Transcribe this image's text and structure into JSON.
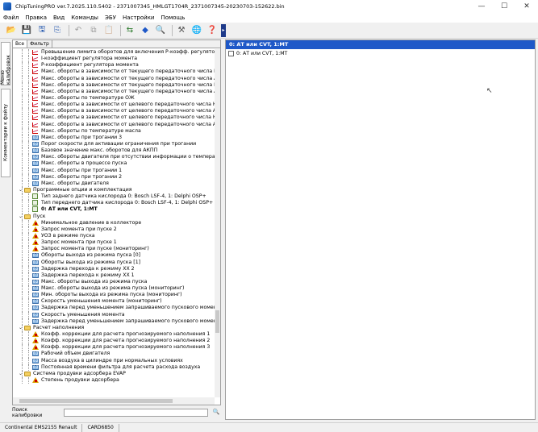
{
  "window": {
    "title": "ChipTuningPRO ver.7.2025.110.5402 - 2371007345_HMLGT1704R_2371007345-20230703-152622.bin"
  },
  "menu": [
    "Файл",
    "Правка",
    "Вид",
    "Команды",
    "ЭБУ",
    "Настройки",
    "Помощь"
  ],
  "side_tabs": {
    "tab1": "Меню калибровок",
    "tab2": "Комментарии к файлу"
  },
  "left_tabs": {
    "all": "Все",
    "filter": "Фильтр"
  },
  "tree": [
    {
      "d": 2,
      "i": "chart",
      "t": "Превышение лимита оборотов для включения Р-коэфф. регулятора м"
    },
    {
      "d": 2,
      "i": "chart",
      "t": "I-коэффициент регулятора момента"
    },
    {
      "d": 2,
      "i": "chart",
      "t": "P-коэффициент регулятора момента"
    },
    {
      "d": 2,
      "i": "chart",
      "t": "Макс. обороты  в зависимости от текущего передаточного числа КПП"
    },
    {
      "d": 2,
      "i": "chart",
      "t": "Макс. обороты  в зависимости от текущего передаточного числа АКПП"
    },
    {
      "d": 2,
      "i": "chart",
      "t": "Макс. обороты  в зависимости от текущего передаточного числа КПП"
    },
    {
      "d": 2,
      "i": "chart",
      "t": "Макс. обороты  в зависимости от текущего передаточного числа АКПП"
    },
    {
      "d": 2,
      "i": "chart",
      "t": "Макс. обороты по температуре ОЖ"
    },
    {
      "d": 2,
      "i": "chart",
      "t": "Макс. обороты  в зависимости от целевого передаточного числа КПП"
    },
    {
      "d": 2,
      "i": "chart",
      "t": "Макс. обороты  в зависимости от целевого передаточного числа АКПП"
    },
    {
      "d": 2,
      "i": "chart",
      "t": "Макс. обороты  в зависимости от целевого передаточного числа КПП"
    },
    {
      "d": 2,
      "i": "chart",
      "t": "Макс. обороты  в зависимости от целевого передаточного числа АКПП"
    },
    {
      "d": 2,
      "i": "chart",
      "t": "Макс. обороты по температуре масла"
    },
    {
      "d": 2,
      "i": "val",
      "t": "Макс. обороты при трогании 3"
    },
    {
      "d": 2,
      "i": "val",
      "t": "Порог скорости для активации ограничения при трогании"
    },
    {
      "d": 2,
      "i": "val",
      "t": "Базовое значение макс. оборотов для АКПП"
    },
    {
      "d": 2,
      "i": "val",
      "t": "Макс. обороты двигателя при отсутствии  информации о температуре"
    },
    {
      "d": 2,
      "i": "val",
      "t": "Макс. обороты в процессе пуска"
    },
    {
      "d": 2,
      "i": "val",
      "t": "Макс. обороты при трогании 1"
    },
    {
      "d": 2,
      "i": "val",
      "t": "Макс. обороты при трогании 2"
    },
    {
      "d": 2,
      "i": "val",
      "t": "Макс. обороты двигателя"
    },
    {
      "d": 1,
      "i": "folder",
      "e": "⌄",
      "t": "Программные опции и комплектация"
    },
    {
      "d": 2,
      "i": "edit",
      "t": "Тип заднего датчика кислорода 0: Bosch LSF-4, 1: Delphi OSP+"
    },
    {
      "d": 2,
      "i": "edit",
      "t": "Тип переднего датчика кислорода 0: Bosch LSF-4, 1: Delphi OSP+"
    },
    {
      "d": 2,
      "i": "edit",
      "t": "0: АТ или CVT, 1:МТ",
      "sel": true
    },
    {
      "d": 1,
      "i": "folder",
      "e": "⌄",
      "t": "Пуск"
    },
    {
      "d": 2,
      "i": "tri",
      "t": "Минимальное давление в коллекторе"
    },
    {
      "d": 2,
      "i": "tri",
      "t": "Запрос момента при пуске 2"
    },
    {
      "d": 2,
      "i": "tri",
      "t": "УОЗ в режиме пуска"
    },
    {
      "d": 2,
      "i": "tri",
      "t": "Запрос момента при пуске 1"
    },
    {
      "d": 2,
      "i": "tri",
      "t": "Запрос момента при пуске (мониторинг)"
    },
    {
      "d": 2,
      "i": "val",
      "t": "Обороты выхода из режима пуска [0]"
    },
    {
      "d": 2,
      "i": "val",
      "t": "Обороты выхода из режима пуска [1]"
    },
    {
      "d": 2,
      "i": "val",
      "t": "Задержка перехода к режиму ХХ 2"
    },
    {
      "d": 2,
      "i": "val",
      "t": "Задержка перехода к режиму ХХ 1"
    },
    {
      "d": 2,
      "i": "val",
      "t": "Макс. обороты выхода из режима пуска"
    },
    {
      "d": 2,
      "i": "val",
      "t": "Макс. обороты выхода из режима пуска (мониторинг)"
    },
    {
      "d": 2,
      "i": "val",
      "t": "Мин. обороты выхода из режима пуска (мониторинг)"
    },
    {
      "d": 2,
      "i": "val",
      "t": "Скорость уменьшения момента (мониторинг)"
    },
    {
      "d": 2,
      "i": "val",
      "t": "Задержка перед уменьшением запрашиваемого пускового момента (м"
    },
    {
      "d": 2,
      "i": "val",
      "t": "Скорость уменьшения момента"
    },
    {
      "d": 2,
      "i": "val",
      "t": "Задержка перед уменьшением запрашиваемого пускового момента"
    },
    {
      "d": 1,
      "i": "folder",
      "e": "⌄",
      "t": "Расчет наполнения"
    },
    {
      "d": 2,
      "i": "tri",
      "t": "Коэфф. коррекции для расчета прогнозируемого наполнения 1"
    },
    {
      "d": 2,
      "i": "tri",
      "t": "Коэфф. коррекции для расчета прогнозируемого наполнения 2"
    },
    {
      "d": 2,
      "i": "tri",
      "t": "Коэфф. коррекции для расчета прогнозируемого наполнения 3"
    },
    {
      "d": 2,
      "i": "val",
      "t": "Рабочий объем двигателя"
    },
    {
      "d": 2,
      "i": "val",
      "t": "Масса воздуха в цилиндре при нормальных условиях"
    },
    {
      "d": 2,
      "i": "val",
      "t": "Постоянная времени фильтра для расчета расхода воздуха"
    },
    {
      "d": 1,
      "i": "folder",
      "e": "⌄",
      "t": "Система продувки адсорбера EVAP"
    },
    {
      "d": 2,
      "i": "tri",
      "t": "Степень продувки адсорбера"
    }
  ],
  "search": {
    "label": "Поиск калибровки",
    "value": ""
  },
  "right": {
    "header": "0: АТ или CVT, 1:МТ",
    "item": "0: АТ или CVT, 1:МТ"
  },
  "status": {
    "ecu": "Continental EMS2155 Renault",
    "code": "CARD6850"
  }
}
